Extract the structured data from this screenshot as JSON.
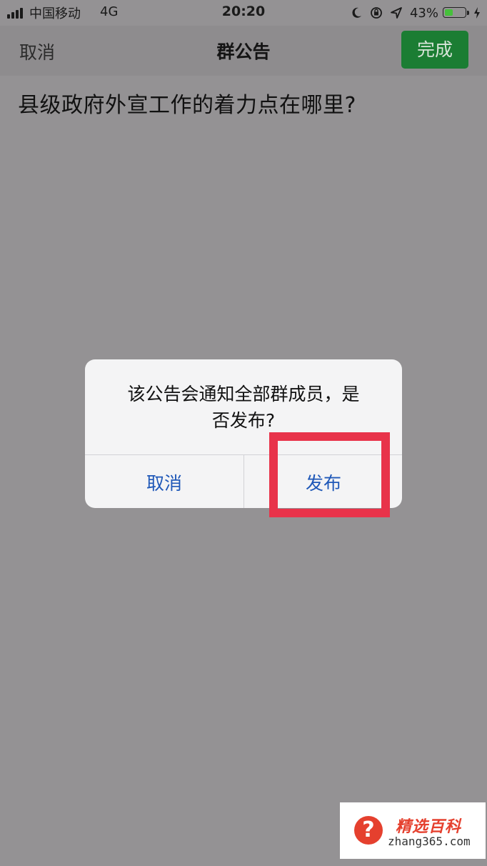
{
  "status_bar": {
    "carrier": "中国移动",
    "network": "4G",
    "time": "20:20",
    "battery_percent": "43%",
    "battery_level": 0.43,
    "icons": [
      "signal-icon",
      "moon-icon",
      "lock-rotation-icon",
      "location-icon",
      "battery-icon",
      "charging-icon"
    ]
  },
  "nav": {
    "cancel_label": "取消",
    "title": "群公告",
    "done_label": "完成"
  },
  "announcement": {
    "text": "县级政府外宣工作的着力点在哪里?"
  },
  "alert": {
    "message_line1": "该公告会通知全部群成员，是",
    "message_line2": "否发布?",
    "cancel_label": "取消",
    "publish_label": "发布"
  },
  "watermark": {
    "title": "精选百科",
    "url": "zhang365.com",
    "icon": "question-icon",
    "accent_color": "#e5402e"
  },
  "colors": {
    "overlay_background": "#949294",
    "done_button": "#1b7d33",
    "highlight": "#e8334a",
    "alert_button_text": "#1f58b8"
  }
}
